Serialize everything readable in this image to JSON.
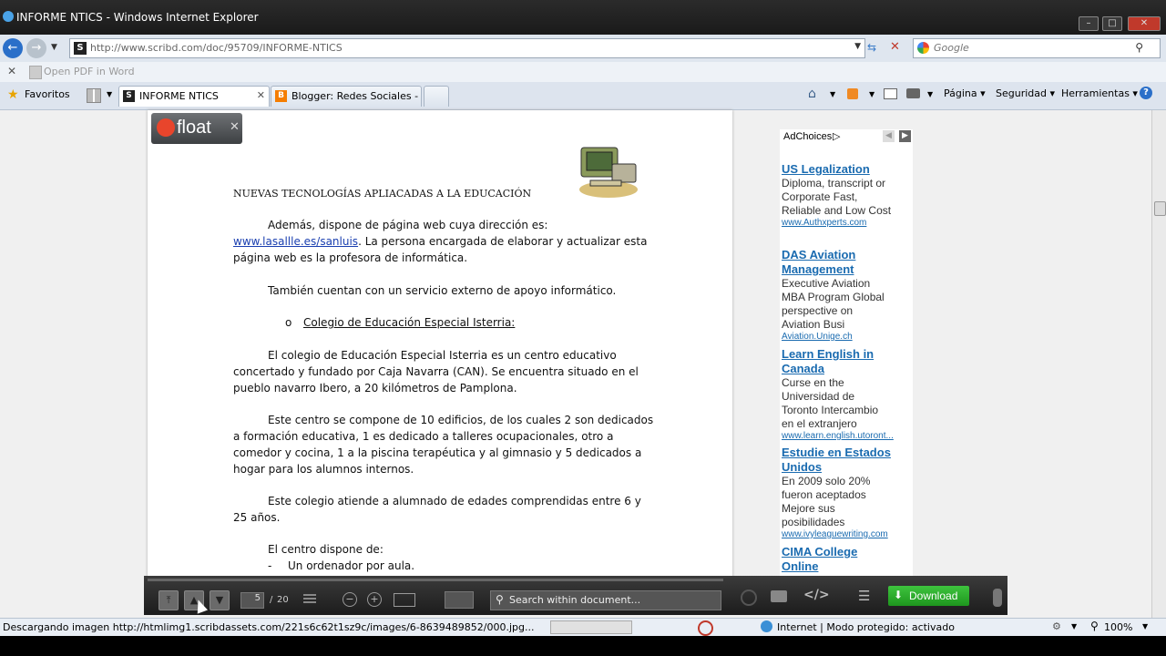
{
  "window": {
    "title": "INFORME NTICS - Windows Internet Explorer"
  },
  "address": {
    "url": "http://www.scribd.com/doc/95709/INFORME-NTICS",
    "search_placeholder": "Google"
  },
  "pdfbar": {
    "label": "Open PDF in Word"
  },
  "favorites": {
    "label": "Favoritos"
  },
  "tabs": [
    {
      "label": "INFORME NTICS"
    },
    {
      "label": "Blogger: Redes Sociales - ..."
    }
  ],
  "commandbar": {
    "page": "Página",
    "security": "Seguridad",
    "tools": "Herramientas"
  },
  "float": {
    "label": "float"
  },
  "document": {
    "heading": "NUEVAS TECNOLOGÍAS APLIACADAS A LA EDUCACIÓN",
    "p1a": "Además, dispone de página web cuya dirección es:",
    "p1link": "www.lasallle.es/sanluis",
    "p1b": ". La persona encargada de elaborar y actualizar  esta",
    "p1c": "página web es la profesora de informática.",
    "p2": "También cuentan con un servicio externo de apoyo informático.",
    "bullet_marker": "o",
    "bullet": "Colegio de Educación Especial Isterria:",
    "p3a": "El colegio de Educación Especial Isterria es un centro educativo",
    "p3b": "concertado y fundado por Caja Navarra (CAN). Se encuentra situado en el",
    "p3c": "pueblo navarro Ibero, a 20 kilómetros de Pamplona.",
    "p4a": "Este centro se compone de 10 edificios, de los cuales 2 son dedicados",
    "p4b": "a formación educativa, 1 es dedicado a talleres ocupacionales, otro a",
    "p4c": "comedor y cocina, 1 a la piscina terapéutica y al gimnasio y 5 dedicados a",
    "p4d": "hogar para los alumnos internos.",
    "p5a": "Este colegio atiende a alumnado de edades comprendidas entre 6 y",
    "p5b": "25 años.",
    "p6": "El centro dispone de:",
    "dash": "-",
    "list1": "Un ordenador por aula."
  },
  "ads": {
    "adchoices": "AdChoices",
    "items": [
      {
        "title1": "US Legalization",
        "title2": "",
        "l1": "Diploma, transcript or",
        "l2": "Corporate Fast,",
        "l3": "Reliable and Low Cost",
        "l4": "",
        "url": "www.Authxperts.com"
      },
      {
        "title1": "DAS Aviation",
        "title2": "Management",
        "l1": "Executive Aviation",
        "l2": "MBA Program Global",
        "l3": "perspective on",
        "l4": "Aviation Busi",
        "url": "Aviation.Unige.ch"
      },
      {
        "title1": "Learn English in",
        "title2": "Canada",
        "l1": "Curse en the",
        "l2": "Universidad de",
        "l3": "Toronto Intercambio",
        "l4": "en el extranjero",
        "url": "www.learn.english.utoront..."
      },
      {
        "title1": "Estudie en Estados",
        "title2": "Unidos",
        "l1": "En 2009 solo 20%",
        "l2": "fueron aceptados",
        "l3": "Mejore sus",
        "l4": "posibilidades",
        "url": "www.ivyleaguewriting.com"
      },
      {
        "title1": "CIMA College",
        "title2": "Online",
        "l1": "",
        "l2": "",
        "l3": "",
        "l4": "",
        "url": ""
      }
    ]
  },
  "scribd": {
    "page_current": "5",
    "page_sep": "/",
    "page_total": "20",
    "search_placeholder": "Search within document...",
    "download": "Download"
  },
  "status": {
    "text": "Descargando imagen http://htmlimg1.scribdassets.com/221s6c62t1sz9c/images/6-8639489852/000.jpg...",
    "zone": "Internet | Modo protegido: activado",
    "zoom": "100%"
  }
}
